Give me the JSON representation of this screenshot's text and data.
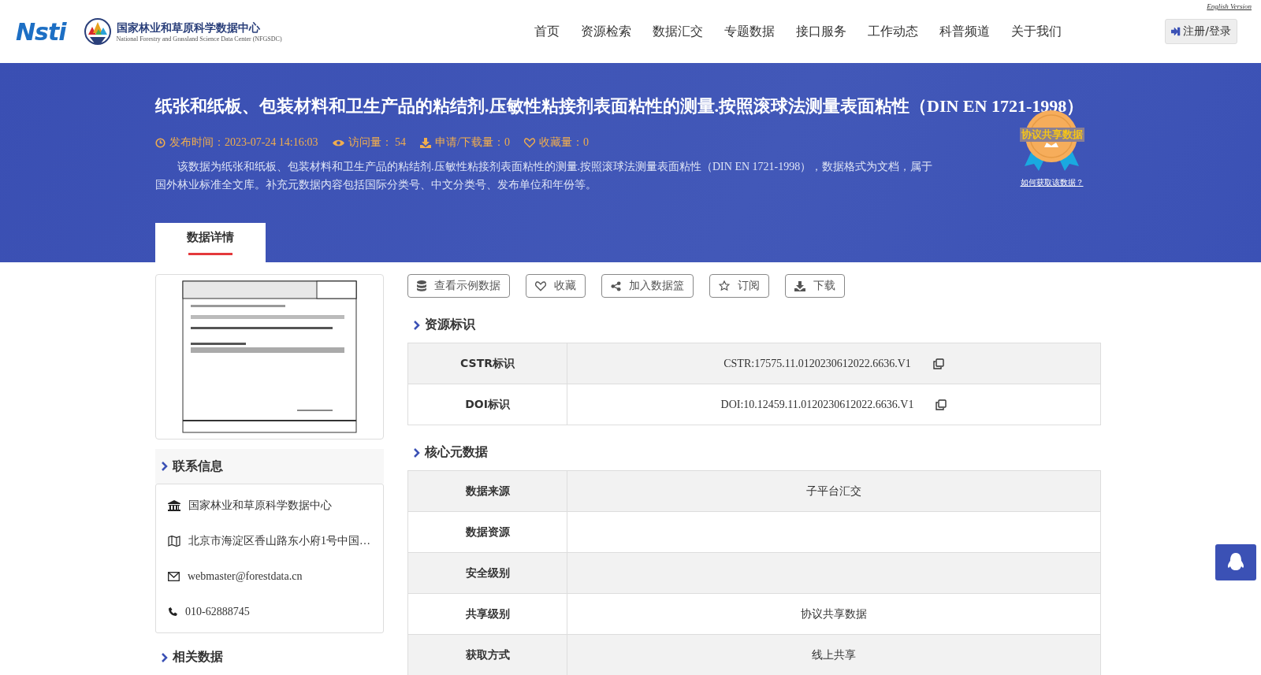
{
  "header": {
    "english_link": "English Version",
    "logo_text": "Nsti",
    "logo_title": "国家林业和草原科学数据中心",
    "logo_subtitle": "National Forestry and Grassland Science Data Center (NFGSDC)",
    "nav": [
      {
        "label": "首页"
      },
      {
        "label": "资源检索"
      },
      {
        "label": "数据汇交"
      },
      {
        "label": "专题数据"
      },
      {
        "label": "接口服务"
      },
      {
        "label": "工作动态"
      },
      {
        "label": "科普频道"
      },
      {
        "label": "关于我们"
      }
    ],
    "login_button": "注册/登录"
  },
  "banner": {
    "title": "纸张和纸板、包装材料和卫生产品的粘结剂.压敏性粘接剂表面粘性的测量.按照滚球法测量表面粘性（DIN EN 1721-1998）",
    "meta": [
      {
        "kind": "time",
        "text": "发布时间：2023-07-24 14:16:03"
      },
      {
        "kind": "views",
        "text": "访问量： 54"
      },
      {
        "kind": "downloads",
        "text": "申请/下载量：0"
      },
      {
        "kind": "favorites",
        "text": "收藏量：0"
      }
    ],
    "description": "该数据为纸张和纸板、包装材料和卫生产品的粘结剂.压敏性粘接剂表面粘性的测量.按照滚球法测量表面粘性（DIN EN 1721-1998），数据格式为文档，属于国外林业标准全文库。补充元数据内容包括国际分类号、中文分类号、发布单位和年份等。",
    "badge": {
      "label": "协议共享数据",
      "link": "如何获取该数据？"
    }
  },
  "tabs": [
    {
      "label": "数据详情",
      "selected": true
    }
  ],
  "contact": {
    "title": "联系信息",
    "items": [
      {
        "kind": "org",
        "text": "国家林业和草原科学数据中心"
      },
      {
        "kind": "address",
        "text": "北京市海淀区香山路东小府1号中国…"
      },
      {
        "kind": "email",
        "text": "webmaster@forestdata.cn"
      },
      {
        "kind": "phone",
        "text": "010-62888745"
      }
    ]
  },
  "related": {
    "title": "相关数据"
  },
  "actions": [
    {
      "kind": "database",
      "label": "查看示例数据"
    },
    {
      "kind": "heart",
      "label": "收藏"
    },
    {
      "kind": "share",
      "label": "加入数据篮"
    },
    {
      "kind": "star",
      "label": "订阅"
    },
    {
      "kind": "download",
      "label": "下载"
    }
  ],
  "sections": [
    {
      "title": "资源标识",
      "rows": [
        {
          "label": "CSTR标识",
          "value": "CSTR:17575.11.0120230612022.6636.V1",
          "copyable": true
        },
        {
          "label": "DOI标识",
          "value": "DOI:10.12459.11.0120230612022.6636.V1",
          "copyable": true
        }
      ]
    },
    {
      "title": "核心元数据",
      "rows": [
        {
          "label": "数据来源",
          "value": "子平台汇交"
        },
        {
          "label": "数据资源"
        },
        {
          "label": "安全级别"
        },
        {
          "label": "共享级别",
          "value": "协议共享数据"
        },
        {
          "label": "获取方式",
          "value": "线上共享"
        }
      ]
    }
  ]
}
